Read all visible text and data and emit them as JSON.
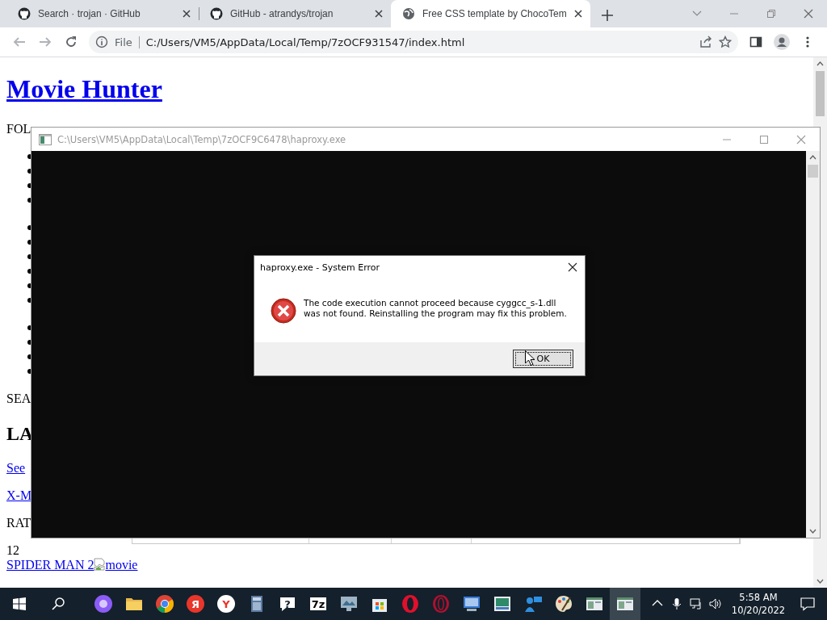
{
  "browser": {
    "tabs": [
      {
        "title": "Search · trojan · GitHub",
        "selected": false
      },
      {
        "title": "GitHub - atrandys/trojan",
        "selected": false
      },
      {
        "title": "Free CSS template by ChocoTem",
        "selected": true
      }
    ],
    "address": {
      "scheme": "File",
      "url": "C:/Users/VM5/AppData/Local/Temp/7zOCF931547/index.html"
    }
  },
  "page": {
    "blocks": [
      {
        "kind": "title",
        "text": "Movie Hunter"
      },
      {
        "kind": "text",
        "text": "FOL"
      },
      {
        "kind": "bullets",
        "items": [
          {
            "kind": "bullet"
          },
          {
            "kind": "bullet"
          },
          {
            "kind": "bullet"
          },
          {
            "kind": "bullet"
          }
        ]
      },
      {
        "kind": "bullets",
        "items": [
          {
            "kind": "bullet"
          },
          {
            "kind": "bullet"
          },
          {
            "kind": "bullet"
          },
          {
            "kind": "bullet"
          },
          {
            "kind": "bullet"
          },
          {
            "kind": "bullet"
          }
        ]
      },
      {
        "kind": "bullets",
        "items": [
          {
            "kind": "bullet"
          },
          {
            "kind": "bullet"
          },
          {
            "kind": "bullet"
          },
          {
            "kind": "bullet"
          }
        ]
      },
      {
        "kind": "text",
        "text": "SEA"
      },
      {
        "kind": "heading",
        "text": "LA"
      },
      {
        "kind": "link",
        "text": "See"
      },
      {
        "kind": "link",
        "text": "X-M"
      },
      {
        "kind": "text",
        "text": "RAT"
      },
      {
        "kind": "line",
        "text": "12"
      },
      {
        "kind": "movie",
        "text": "SPIDER MAN 2",
        "alt": "movie"
      }
    ]
  },
  "console": {
    "title": "C:\\Users\\VM5\\AppData\\Local\\Temp\\7zOCF9C6478\\haproxy.exe"
  },
  "dialog": {
    "title": "haproxy.exe - System Error",
    "message": [
      "The code execution cannot proceed because cyggcc_s-1.dll",
      "was not found. Reinstalling the program may fix this problem."
    ],
    "button": "OK"
  },
  "taskbar": {
    "apps": [
      {
        "kind": "assistant",
        "selected": false
      },
      {
        "kind": "folder",
        "selected": false
      },
      {
        "kind": "chrome",
        "selected": false
      },
      {
        "kind": "letter-red",
        "label": "Я",
        "selected": false
      },
      {
        "kind": "letter-white",
        "label": "Y",
        "selected": false
      },
      {
        "kind": "calculator",
        "selected": false
      },
      {
        "kind": "help",
        "label": "?",
        "selected": false
      },
      {
        "kind": "archiver",
        "label": "7z",
        "selected": false
      },
      {
        "kind": "monitor",
        "selected": false
      },
      {
        "kind": "store",
        "selected": false
      },
      {
        "kind": "ring-red",
        "selected": false
      },
      {
        "kind": "ring-dark",
        "selected": false
      },
      {
        "kind": "computer",
        "selected": false
      },
      {
        "kind": "photo",
        "selected": false
      },
      {
        "kind": "people",
        "selected": false
      },
      {
        "kind": "paint",
        "selected": false
      },
      {
        "kind": "window",
        "selected": false
      },
      {
        "kind": "window",
        "selected": true
      }
    ],
    "time": "5:58 AM",
    "date": "10/20/2022"
  }
}
